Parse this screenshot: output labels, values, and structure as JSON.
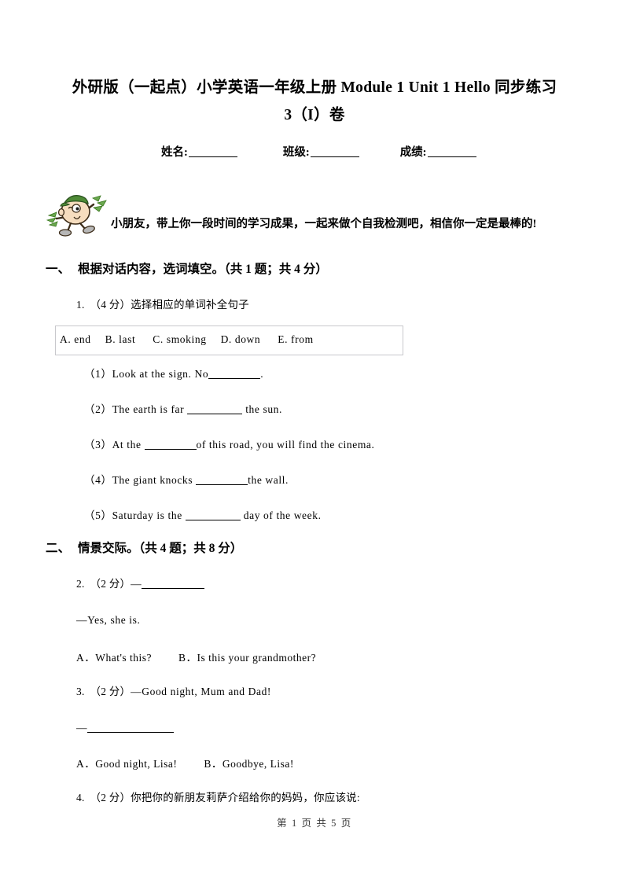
{
  "document": {
    "title_line_1": "外研版（一起点）小学英语一年级上册 Module 1 Unit 1 Hello 同步练习",
    "title_line_2": "3（I）卷"
  },
  "student_info": {
    "name_label": "姓名:",
    "class_label": "班级:",
    "score_label": "成绩:",
    "name_value": "",
    "class_value": "",
    "score_value": ""
  },
  "greeting": {
    "mascot_icon": "cartoon-boy-icon",
    "text": "小朋友，带上你一段时间的学习成果，一起来做个自我检测吧，相信你一定是最棒的!"
  },
  "sections": [
    {
      "number": "一、",
      "title": "根据对话内容，选词填空。",
      "meta": "（共 1 题；共 4 分）"
    },
    {
      "number": "二、",
      "title": "情景交际。",
      "meta": "（共 4 题；共 8 分）"
    }
  ],
  "question_1": {
    "number": "1.",
    "points": "（4 分）",
    "prompt": "选择相应的单词补全句子",
    "word_bank": [
      "A. end",
      "B. last",
      "C. smoking",
      "D. down",
      "E. from"
    ],
    "items": [
      {
        "label": "（1）",
        "before": "Look at the sign. No",
        "after": "."
      },
      {
        "label": "（2）",
        "before": "The earth is far ",
        "after": " the sun."
      },
      {
        "label": "（3）",
        "before": "At the ",
        "after": "of this road, you will find the cinema."
      },
      {
        "label": "（4）",
        "before": "The giant knocks ",
        "after": "the wall."
      },
      {
        "label": "（5）",
        "before": "Saturday is the ",
        "after": " day of the week."
      }
    ]
  },
  "question_2": {
    "number": "2.",
    "points": "（2 分）",
    "dash": "—",
    "answer_line": "—Yes, she is.",
    "option_a": "A．What's this?",
    "option_b": "B．Is this your grandmother?"
  },
  "question_3": {
    "number": "3.",
    "points": "（2 分）",
    "prompt": "—Good night, Mum and Dad!",
    "dash": "—",
    "option_a": "A．Good night, Lisa!",
    "option_b": "B．Goodbye, Lisa!"
  },
  "question_4": {
    "number": "4.",
    "points": "（2 分）",
    "prompt": "你把你的新朋友莉萨介绍给你的妈妈，你应该说:"
  },
  "footer": {
    "text": "第 1 页 共 5 页"
  }
}
